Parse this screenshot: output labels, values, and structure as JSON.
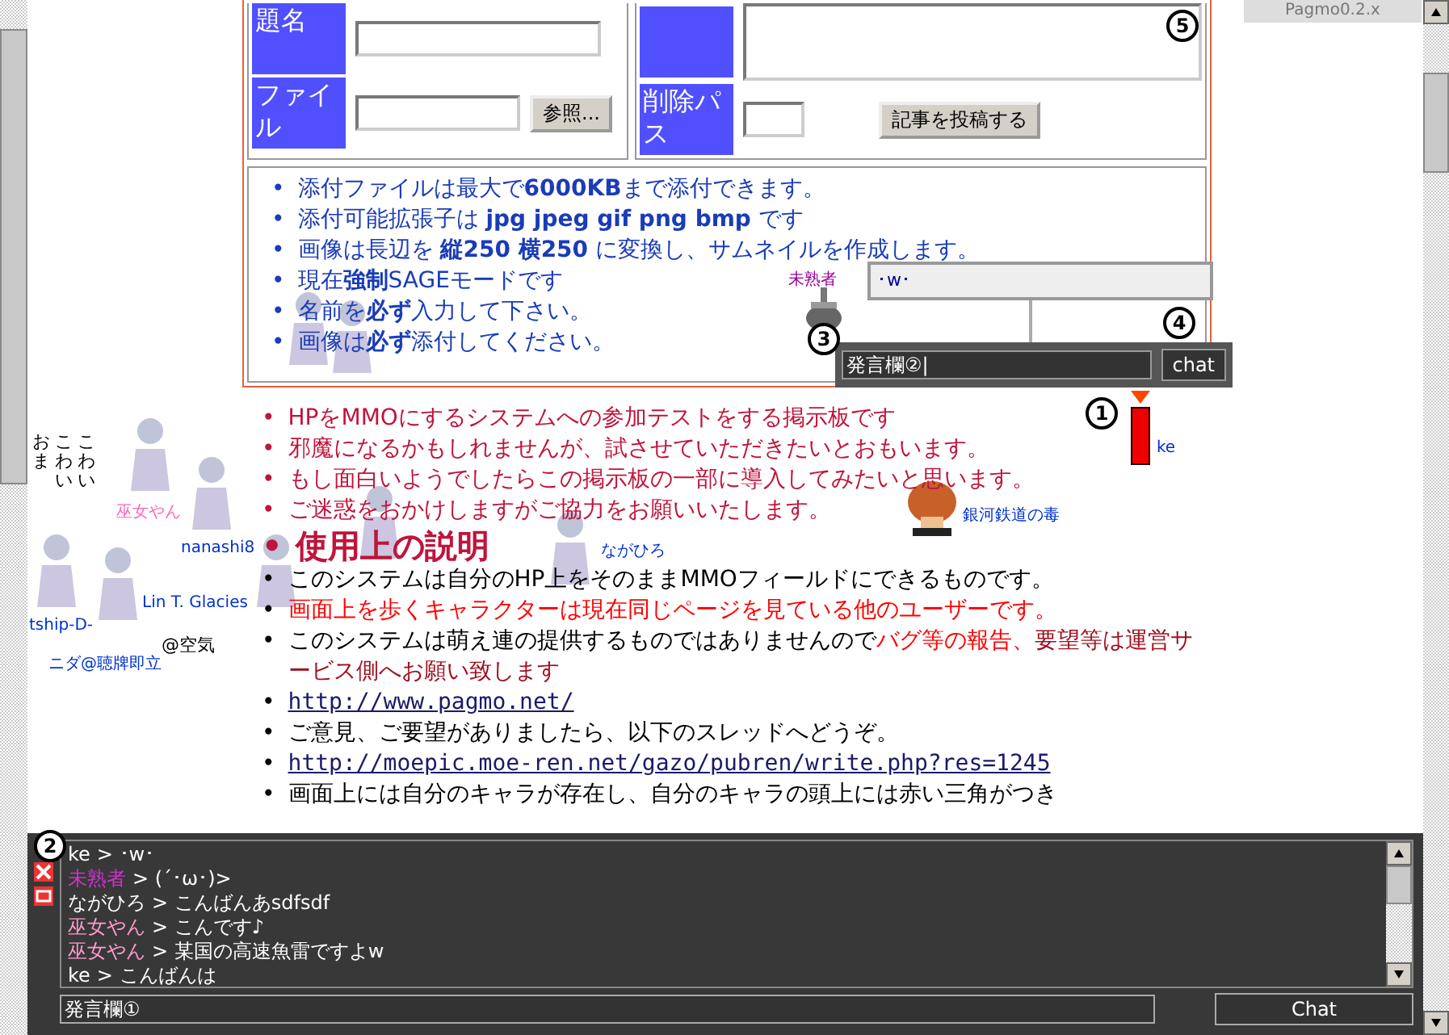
{
  "version_label": "Pagmo0.2.x",
  "form": {
    "subject_label": "題名",
    "file_label": "ファイル",
    "browse_button": "参照...",
    "delete_label": "削除パス",
    "submit_button": "記事を投稿する"
  },
  "notes": [
    {
      "marker": "•",
      "text": "添付ファイルは最大で**6000KB**まで添付できます。"
    },
    {
      "marker": "•",
      "text": "添付可能拡張子は **jpg jpeg gif png bmp** です"
    },
    {
      "marker": "•",
      "text": "画像は長辺を **縦250 横250** に変換し、サムネイルを作成します。"
    },
    {
      "marker": "•",
      "text": "現在**強制**SAGEモードです"
    },
    {
      "marker": "•",
      "text": "名前を**必ず**入力して下さい。"
    },
    {
      "marker": "•",
      "text": "画像は**必ず**添付してください。"
    }
  ],
  "intro": [
    {
      "marker": "•",
      "text": "HPをMMOにするシステムへの参加テストをする掲示板です"
    },
    {
      "marker": "•",
      "text": "邪魔になるかもしれませんが、試させていただきたいとおもいます。"
    },
    {
      "marker": "•",
      "text": "もし面白いようでしたらこの掲示板の一部に導入してみたいと思います。"
    },
    {
      "marker": "•",
      "text": "ご迷惑をおかけしますがご協力をお願いいたします。"
    }
  ],
  "heading": {
    "marker": "•",
    "text": "使用上の説明"
  },
  "usage": [
    {
      "marker": "•",
      "kind": "text",
      "segments": [
        {
          "text": "このシステムは自分のHP上をそのままMMOフィールドにできるものです。",
          "kind": "plain"
        }
      ]
    },
    {
      "marker": "•",
      "kind": "text",
      "segments": [
        {
          "text": "画面上を歩くキャラクターは現在同じページを見ている他のユーザーです。",
          "kind": "alert"
        }
      ]
    },
    {
      "marker": "•",
      "kind": "text",
      "segments": [
        {
          "text": "このシステムは萌え連の提供するものではありませんので",
          "kind": "plain"
        },
        {
          "text": "バグ等の報告、",
          "kind": "alert"
        },
        {
          "text": "要望等は運営サービス側へお願い致します",
          "kind": "warn"
        }
      ]
    },
    {
      "marker": "•",
      "kind": "link",
      "segments": [
        {
          "text": "http://www.pagmo.net/"
        }
      ]
    },
    {
      "marker": "•",
      "kind": "text",
      "segments": [
        {
          "text": "ご意見、ご要望がありましたら、以下のスレッドへどうぞ。",
          "kind": "plain"
        }
      ]
    },
    {
      "marker": "•",
      "kind": "link",
      "segments": [
        {
          "text": "http://moepic.moe-ren.net/gazo/pubren/write.php?res=1245"
        }
      ]
    },
    {
      "marker": "•",
      "kind": "text",
      "segments": [
        {
          "text": "画面上には自分のキャラが存在し、自分のキャラの頭上には赤い三角がつき",
          "kind": "plain"
        }
      ]
    }
  ],
  "characters": [
    {
      "name": "未熟者",
      "color": "#990099",
      "kind": "ship"
    },
    {
      "kind": "figure"
    },
    {
      "kind": "figure"
    },
    {
      "name": "巫女やん",
      "color": "#ff66bb",
      "kind": "figure"
    },
    {
      "name": "nanashi8",
      "color": "#0033cc",
      "kind": "figure"
    },
    {
      "name": "tship-D-",
      "color": "#0033cc",
      "kind": "figure"
    },
    {
      "name": "ニダ@聴牌即立",
      "color": "#0033cc",
      "kind": "figure"
    },
    {
      "name": "Lin T. Glacies",
      "color": "#0033cc",
      "kind": "figure"
    },
    {
      "kind": "figure"
    },
    {
      "name": "銀河鉄道の毒",
      "color": "#0033cc",
      "kind": "mushroom"
    },
    {
      "name": "ながひろ",
      "color": "#0033cc",
      "kind": "figure"
    },
    {
      "name": "ke",
      "color": "#0033cc",
      "kind": "block"
    }
  ],
  "floating_texts": [
    {
      "text": "@空気"
    },
    {
      "text": "おま"
    },
    {
      "text": "こわい"
    },
    {
      "text": "こわい"
    }
  ],
  "speech_bubble": {
    "text": "･w･"
  },
  "mini_chat": {
    "value": "発言欄②|",
    "button": "chat"
  },
  "chat": {
    "messages": [
      {
        "name": "ke",
        "color": "#ffffff",
        "text": "> ･w･"
      },
      {
        "name": "未熟者",
        "color": "#cc33cc",
        "text": "> (´･ω･)>"
      },
      {
        "name": "ながひろ",
        "color": "#ffffff",
        "text": "> こんばんあsdfsdf"
      },
      {
        "name": "巫女やん",
        "color": "#ff99cc",
        "text": "> こんです♪"
      },
      {
        "name": "巫女やん",
        "color": "#ff99cc",
        "text": "> 某国の高速魚雷ですよw"
      },
      {
        "name": "ke",
        "color": "#ffffff",
        "text": "> こんばんは"
      }
    ],
    "input": "発言欄①",
    "button": "Chat"
  },
  "callouts": [
    "1",
    "2",
    "3",
    "4",
    "5"
  ]
}
